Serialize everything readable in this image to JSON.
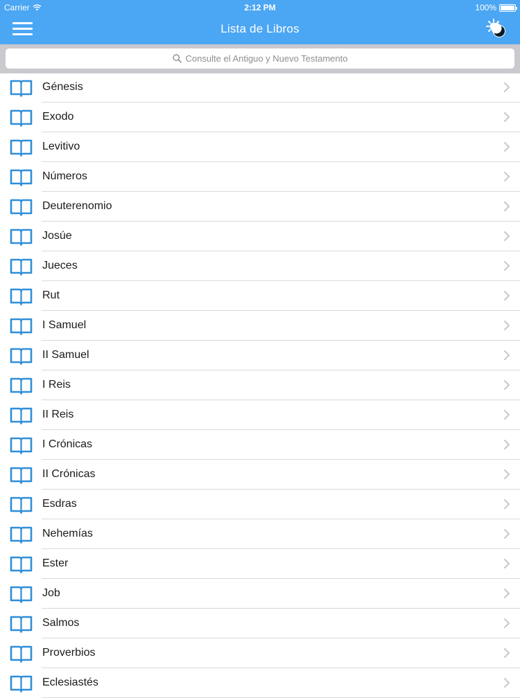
{
  "status": {
    "carrier": "Carrier",
    "time": "2:12 PM",
    "battery": "100%"
  },
  "nav": {
    "title": "Lista de Libros",
    "menu_icon": "hamburger-menu-icon",
    "theme_icon": "day-night-toggle-icon"
  },
  "search": {
    "placeholder": "Consulte el Antiguo y Nuevo Testamento",
    "icon": "search-icon"
  },
  "colors": {
    "accent": "#4ba6f3",
    "book_icon": "#2f8ed8"
  },
  "books": [
    {
      "label": "Génesis"
    },
    {
      "label": "Exodo"
    },
    {
      "label": "Levitivo"
    },
    {
      "label": "Números"
    },
    {
      "label": "Deuterenomio"
    },
    {
      "label": "Josúe"
    },
    {
      "label": "Jueces"
    },
    {
      "label": "Rut"
    },
    {
      "label": "I Samuel"
    },
    {
      "label": "II Samuel"
    },
    {
      "label": "I Reis"
    },
    {
      "label": "II Reis"
    },
    {
      "label": "I Crónicas"
    },
    {
      "label": "II Crónicas"
    },
    {
      "label": "Esdras"
    },
    {
      "label": "Nehemías"
    },
    {
      "label": "Ester"
    },
    {
      "label": "Job"
    },
    {
      "label": "Salmos"
    },
    {
      "label": "Proverbios"
    },
    {
      "label": "Eclesiastés"
    }
  ]
}
